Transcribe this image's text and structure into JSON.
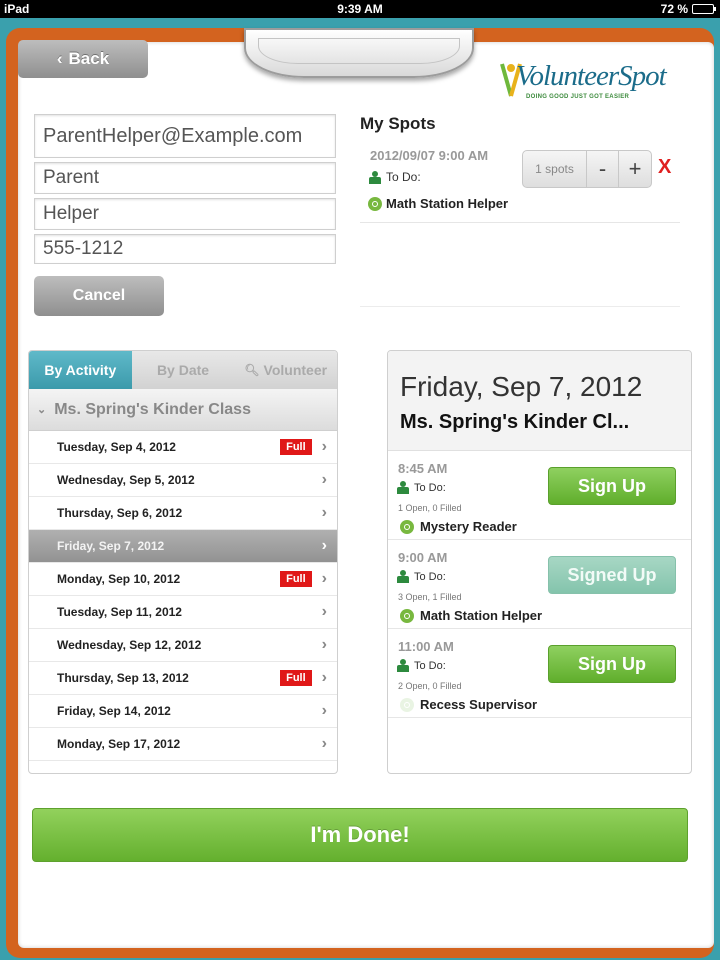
{
  "status_bar": {
    "device": "iPad",
    "time": "9:39 AM",
    "battery": "72 %",
    "battery_level": 0.72
  },
  "header": {
    "back_label": "Back",
    "logo_text": "VolunteerSpot",
    "logo_tagline": "DOING GOOD JUST GOT EASIER"
  },
  "form": {
    "email": "ParentHelper@Example.com",
    "first_name": "Parent",
    "last_name": "Helper",
    "phone": "555-1212",
    "cancel_label": "Cancel"
  },
  "my_spots": {
    "title": "My Spots",
    "items": [
      {
        "time": "2012/09/07 9:00 AM",
        "todo": "To Do:",
        "name": "Math Station Helper",
        "count_label": "1 spots",
        "minus": "-",
        "plus": "+",
        "remove": "X"
      }
    ]
  },
  "tabs": [
    {
      "label": "By Activity",
      "active": true
    },
    {
      "label": "By Date",
      "active": false
    },
    {
      "label": "Volunteer",
      "active": false
    }
  ],
  "group": {
    "title": "Ms. Spring's Kinder Class"
  },
  "dates": [
    {
      "label": "Tuesday, Sep 4, 2012",
      "badge": "Full"
    },
    {
      "label": "Wednesday, Sep 5, 2012",
      "badge": ""
    },
    {
      "label": "Thursday, Sep 6, 2012",
      "badge": ""
    },
    {
      "label": "Friday, Sep 7, 2012",
      "badge": "",
      "selected": true
    },
    {
      "label": "Monday, Sep 10, 2012",
      "badge": "Full"
    },
    {
      "label": "Tuesday, Sep 11, 2012",
      "badge": ""
    },
    {
      "label": "Wednesday, Sep 12, 2012",
      "badge": ""
    },
    {
      "label": "Thursday, Sep 13, 2012",
      "badge": "Full"
    },
    {
      "label": "Friday, Sep 14, 2012",
      "badge": ""
    },
    {
      "label": "Monday, Sep 17, 2012",
      "badge": ""
    }
  ],
  "detail": {
    "date": "Friday, Sep 7, 2012",
    "class_name": "Ms. Spring's Kinder Cl...",
    "slots": [
      {
        "time": "8:45 AM",
        "todo": "To Do:",
        "counts": "1 Open, 0 Filled",
        "name": "Mystery Reader",
        "button": "Sign Up",
        "state": "signup"
      },
      {
        "time": "9:00 AM",
        "todo": "To Do:",
        "counts": "3 Open, 1 Filled",
        "name": "Math Station Helper",
        "button": "Signed Up",
        "state": "signedup"
      },
      {
        "time": "11:00 AM",
        "todo": "To Do:",
        "counts": "2 Open, 0 Filled",
        "name": "Recess Supervisor",
        "button": "Sign Up",
        "state": "signup"
      }
    ]
  },
  "done_label": "I'm Done!",
  "colors": {
    "teal": "#3aa0ad",
    "orange_board": "#d3631f",
    "green": "#64b02e",
    "full_red": "#e01818"
  }
}
